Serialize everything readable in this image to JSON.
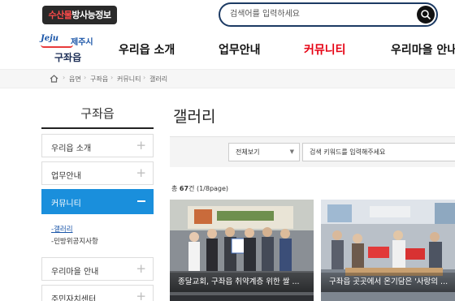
{
  "header": {
    "badge_prefix": "수산물",
    "badge_rest": "방사능정보",
    "search_placeholder": "검색어를 입력하세요"
  },
  "logo": {
    "jeju": "Jeju",
    "city": "제주시",
    "town": "구좌읍"
  },
  "nav": {
    "items": [
      "우리읍 소개",
      "업무안내",
      "커뮤니티",
      "우리마을 안내"
    ]
  },
  "breadcrumb": [
    "홈",
    "읍면",
    "구좌읍",
    "커뮤니티",
    "갤러리"
  ],
  "sidebar": {
    "title": "구좌읍",
    "items": [
      "우리읍 소개",
      "업무안내",
      "커뮤니티",
      "우리마을 안내",
      "주민자치센터"
    ],
    "sub_items": [
      "갤러리",
      "민방위공지사항"
    ]
  },
  "content": {
    "title": "갤러리",
    "filter_select": "전체보기",
    "keyword_placeholder": "검색 키워드를 입력해주세요",
    "count_prefix": "총 ",
    "count_num": "67",
    "count_suffix": "건 (1/8page)"
  },
  "gallery": [
    {
      "caption": "종달교회, 구좌읍 취약계층 위한 쌀 ..."
    },
    {
      "caption": "구좌읍 곳곳에서 온기담은 '사랑의 ..."
    }
  ],
  "colors": {
    "accent_blue": "#1a8fdc",
    "nav_active": "#e60012",
    "badge_bg": "#2a2a2a"
  }
}
